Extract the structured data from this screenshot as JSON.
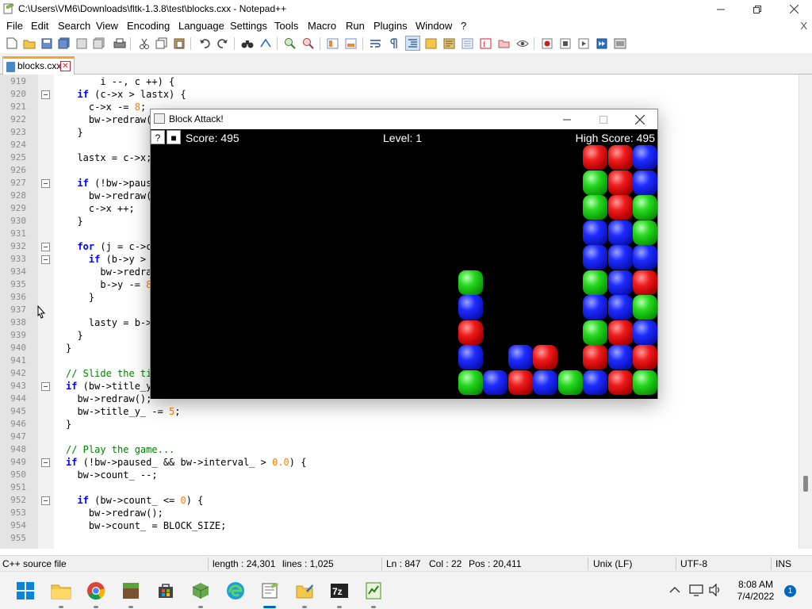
{
  "window": {
    "title": "C:\\Users\\VM6\\Downloads\\fltk-1.3.8\\test\\blocks.cxx - Notepad++"
  },
  "menu": {
    "items": [
      "File",
      "Edit",
      "Search",
      "View",
      "Encoding",
      "Language",
      "Settings",
      "Tools",
      "Macro",
      "Run",
      "Plugins",
      "Window",
      "?"
    ],
    "close_doc": "X"
  },
  "tab": {
    "label": "blocks.cxx",
    "close": "✕"
  },
  "editor": {
    "lines": [
      {
        "n": "919",
        "text": "      i --, c ++) {"
      },
      {
        "n": "920",
        "text": "  if (c->x > lastx) {"
      },
      {
        "n": "921",
        "text": "    c->x -= 8;"
      },
      {
        "n": "922",
        "text": "    bw->redraw();"
      },
      {
        "n": "923",
        "text": "  }"
      },
      {
        "n": "924",
        "text": ""
      },
      {
        "n": "925",
        "text": "  lastx = c->x;"
      },
      {
        "n": "926",
        "text": ""
      },
      {
        "n": "927",
        "text": "  if (!bw->paused_ && c->x <= 0) {"
      },
      {
        "n": "928",
        "text": "    bw->redraw();"
      },
      {
        "n": "929",
        "text": "    c->x ++;"
      },
      {
        "n": "930",
        "text": "  }"
      },
      {
        "n": "931",
        "text": ""
      },
      {
        "n": "932",
        "text": "  for (j = c->count, b = c->blocks, lasty = 0; j > 0; j --, b ++) {"
      },
      {
        "n": "933",
        "text": "    if (b->y > lasty) {"
      },
      {
        "n": "934",
        "text": "      bw->redraw();"
      },
      {
        "n": "935",
        "text": "      b->y -= 8;"
      },
      {
        "n": "936",
        "text": "    }"
      },
      {
        "n": "937",
        "text": ""
      },
      {
        "n": "938",
        "text": "    lasty = b->y + BLOCK_SIZE;"
      },
      {
        "n": "939",
        "text": "  }"
      },
      {
        "n": "940",
        "text": "}"
      },
      {
        "n": "941",
        "text": ""
      },
      {
        "n": "942",
        "text": "// Slide the title text as needed..."
      },
      {
        "n": "943",
        "text": "if (bw->title_y_ > 0) {"
      },
      {
        "n": "944",
        "text": "  bw->redraw();"
      },
      {
        "n": "945",
        "text": "  bw->title_y_ -= 5;"
      },
      {
        "n": "946",
        "text": "}"
      },
      {
        "n": "947",
        "text": ""
      },
      {
        "n": "948",
        "text": "// Play the game..."
      },
      {
        "n": "949",
        "text": "if (!bw->paused_ && bw->interval_ > 0.0) {"
      },
      {
        "n": "950",
        "text": "  bw->count_ --;"
      },
      {
        "n": "951",
        "text": ""
      },
      {
        "n": "952",
        "text": "  if (bw->count_ <= 0) {"
      },
      {
        "n": "953",
        "text": "    bw->redraw();"
      },
      {
        "n": "954",
        "text": "    bw->count_ = BLOCK_SIZE;"
      },
      {
        "n": "955",
        "text": ""
      }
    ]
  },
  "statusbar": {
    "filetype": "C++ source file",
    "length": "length : 24,301",
    "lines": "lines : 1,025",
    "ln": "Ln : 847",
    "col": "Col : 22",
    "pos": "Pos : 20,411",
    "eol": "Unix (LF)",
    "encoding": "UTF-8",
    "mode": "INS"
  },
  "game": {
    "title": "Block Attack!",
    "help_button": "?",
    "pause_button": "■",
    "score": "Score: 495",
    "level": "Level: 1",
    "high_score": "High Score: 495",
    "blocks": [
      {
        "c": "red",
        "col": 0,
        "row": 0
      },
      {
        "c": "red",
        "col": 1,
        "row": 0
      },
      {
        "c": "blue",
        "col": 2,
        "row": 0
      },
      {
        "c": "green",
        "col": 0,
        "row": 1
      },
      {
        "c": "red",
        "col": 1,
        "row": 1
      },
      {
        "c": "blue",
        "col": 2,
        "row": 1
      },
      {
        "c": "green",
        "col": 0,
        "row": 2
      },
      {
        "c": "red",
        "col": 1,
        "row": 2
      },
      {
        "c": "green",
        "col": 2,
        "row": 2
      },
      {
        "c": "blue",
        "col": 0,
        "row": 3
      },
      {
        "c": "blue",
        "col": 1,
        "row": 3
      },
      {
        "c": "green",
        "col": 2,
        "row": 3
      },
      {
        "c": "blue",
        "col": 0,
        "row": 4
      },
      {
        "c": "blue",
        "col": 1,
        "row": 4
      },
      {
        "c": "blue",
        "col": 2,
        "row": 4
      },
      {
        "c": "green",
        "col": 0,
        "row": 5
      },
      {
        "c": "blue",
        "col": 1,
        "row": 5
      },
      {
        "c": "red",
        "col": 2,
        "row": 5
      },
      {
        "c": "blue",
        "col": 0,
        "row": 6
      },
      {
        "c": "blue",
        "col": 1,
        "row": 6
      },
      {
        "c": "green",
        "col": 2,
        "row": 6
      },
      {
        "c": "green",
        "col": 0,
        "row": 7
      },
      {
        "c": "red",
        "col": 1,
        "row": 7
      },
      {
        "c": "blue",
        "col": 2,
        "row": 7
      },
      {
        "c": "red",
        "col": 0,
        "row": 8
      },
      {
        "c": "blue",
        "col": 1,
        "row": 8
      },
      {
        "c": "red",
        "col": 2,
        "row": 8
      },
      {
        "c": "blue",
        "col": 0,
        "row": 9
      },
      {
        "c": "red",
        "col": 1,
        "row": 9
      },
      {
        "c": "green",
        "col": 2,
        "row": 9
      },
      {
        "c": "green",
        "col": -5,
        "row": 9
      },
      {
        "c": "blue",
        "col": -4,
        "row": 9
      },
      {
        "c": "red",
        "col": -3,
        "row": 9
      },
      {
        "c": "blue",
        "col": -2,
        "row": 9
      },
      {
        "c": "green",
        "col": -1,
        "row": 9
      },
      {
        "c": "blue",
        "col": -5,
        "row": 8
      },
      {
        "c": "blue",
        "col": -3,
        "row": 8
      },
      {
        "c": "red",
        "col": -2,
        "row": 8
      },
      {
        "c": "red",
        "col": -5,
        "row": 7
      },
      {
        "c": "blue",
        "col": -5,
        "row": 6
      },
      {
        "c": "green",
        "col": -5,
        "row": 5
      }
    ]
  },
  "taskbar": {
    "time": "8:08 AM",
    "date": "7/4/2022",
    "notifications": "1",
    "apps": [
      "start",
      "file-explorer",
      "chrome",
      "minecraft",
      "store",
      "minecraft-alt",
      "edge",
      "notepad++",
      "folder-alt",
      "7zip",
      "spreadsheet"
    ]
  },
  "colors": {
    "tab_accent": "#f5a623",
    "keyword": "#0000ff",
    "number": "#ff8000",
    "comment": "#008000",
    "taskbar_accent": "#0067c0"
  }
}
